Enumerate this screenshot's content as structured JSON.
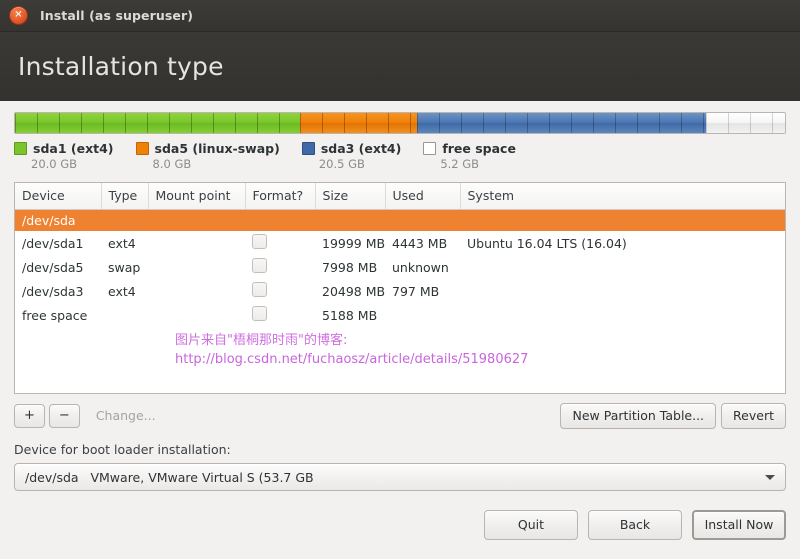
{
  "window": {
    "title": "Install (as superuser)",
    "close_icon": "close-icon"
  },
  "header": {
    "page_title": "Installation type"
  },
  "partition_bar": {
    "segments": [
      {
        "name": "sda1",
        "color": "#7ac52b",
        "percent": 37.0
      },
      {
        "name": "sda5",
        "color": "#ef8008",
        "percent": 15.2
      },
      {
        "name": "sda3",
        "color": "#3f6aa6",
        "percent": 37.5
      },
      {
        "name": "free space",
        "color": "#ffffff",
        "percent": 10.3
      }
    ]
  },
  "legend": [
    {
      "label": "sda1 (ext4)",
      "size": "20.0 GB",
      "color": "#7ac52b"
    },
    {
      "label": "sda5 (linux-swap)",
      "size": "8.0 GB",
      "color": "#ef8008"
    },
    {
      "label": "sda3 (ext4)",
      "size": "20.5 GB",
      "color": "#3f6aa6"
    },
    {
      "label": "free space",
      "size": "5.2 GB",
      "color": "#ffffff"
    }
  ],
  "table": {
    "columns": [
      "Device",
      "Type",
      "Mount point",
      "Format?",
      "Size",
      "Used",
      "System"
    ],
    "rows": [
      {
        "kind": "disk",
        "device": "/dev/sda",
        "type": "",
        "mount": "",
        "format": false,
        "size": "",
        "used": "",
        "system": ""
      },
      {
        "kind": "partition",
        "device": "/dev/sda1",
        "type": "ext4",
        "mount": "",
        "format": false,
        "size": "19999 MB",
        "used": "4443 MB",
        "system": "Ubuntu 16.04 LTS (16.04)"
      },
      {
        "kind": "partition",
        "device": "/dev/sda5",
        "type": "swap",
        "mount": "",
        "format": false,
        "size": "7998 MB",
        "used": "unknown",
        "system": ""
      },
      {
        "kind": "partition",
        "device": "/dev/sda3",
        "type": "ext4",
        "mount": "",
        "format": false,
        "size": "20498 MB",
        "used": "797 MB",
        "system": ""
      },
      {
        "kind": "free",
        "device": "free space",
        "type": "",
        "mount": "",
        "format": false,
        "size": "5188 MB",
        "used": "",
        "system": ""
      }
    ]
  },
  "watermark": {
    "line1": "图片来自\"梧桐那时雨\"的博客:",
    "line2": "http://blog.csdn.net/fuchaosz/article/details/51980627",
    "color": "#cf6fe0"
  },
  "toolbar": {
    "add_label": "+",
    "remove_label": "−",
    "change_label": "Change...",
    "new_partition_table_label": "New Partition Table...",
    "revert_label": "Revert"
  },
  "bootloader": {
    "label": "Device for boot loader installation:",
    "selected": "/dev/sda   VMware, VMware Virtual S (53.7 GB"
  },
  "footer": {
    "quit_label": "Quit",
    "back_label": "Back",
    "install_label": "Install Now"
  }
}
